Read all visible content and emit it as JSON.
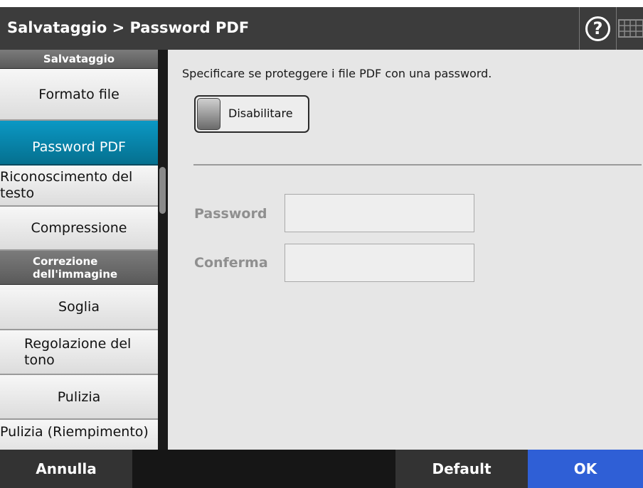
{
  "header": {
    "title": "Salvataggio > Password PDF",
    "help_label": "?"
  },
  "sidebar": {
    "sections": [
      {
        "header": "Salvataggio",
        "items": [
          "Formato file",
          "Password PDF",
          "Riconoscimento del testo",
          "Compressione"
        ]
      },
      {
        "header": "Correzione dell'immagine",
        "items": [
          "Soglia",
          "Regolazione del tono",
          "Pulizia",
          "Pulizia (Riempimento)"
        ]
      }
    ],
    "active_item": "Password PDF"
  },
  "main": {
    "description": "Specificare se proteggere i file PDF con una password.",
    "toggle_label": "Disabilitare",
    "password_label": "Password",
    "password_value": "",
    "confirm_label": "Conferma",
    "confirm_value": ""
  },
  "footer": {
    "cancel_label": "Annulla",
    "default_label": "Default",
    "ok_label": "OK"
  },
  "colors": {
    "active_item": "#0b8fb8",
    "ok_button": "#2f5fd6",
    "titlebar": "#3c3c3c"
  },
  "icons": [
    "help-icon",
    "keyboard-icon"
  ]
}
